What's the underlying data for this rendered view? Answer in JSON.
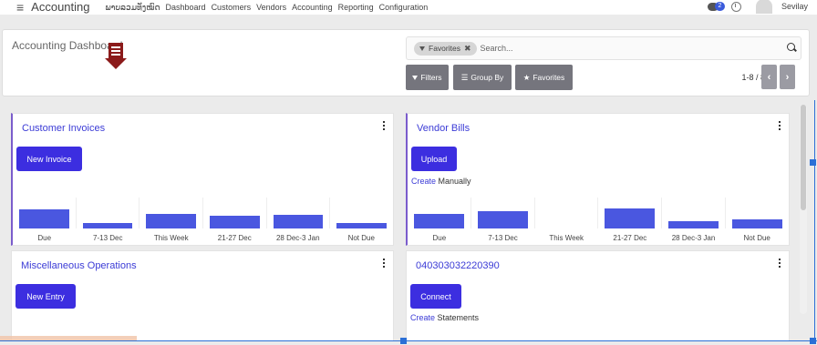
{
  "topnav": {
    "app_title": "Accounting",
    "menu": [
      "ພາບລວມທັງໝົດ",
      "Dashboard",
      "Customers",
      "Vendors",
      "Accounting",
      "Reporting",
      "Configuration"
    ],
    "chat_count": "2",
    "username": "Sevilay"
  },
  "control_panel": {
    "title": "Accounting Dashboard",
    "facet_label": "Favorites",
    "search_placeholder": "Search...",
    "filters_label": "Filters",
    "groupby_label": "Group By",
    "favorites_label": "Favorites",
    "pager": "1-8 / 8"
  },
  "cards": {
    "customer_invoices": {
      "title": "Customer Invoices",
      "button": "New Invoice",
      "graph": [
        {
          "label": "Due",
          "value": 0.62
        },
        {
          "label": "7-13 Dec",
          "value": 0.18
        },
        {
          "label": "This Week",
          "value": 0.48
        },
        {
          "label": "21-27 Dec",
          "value": 0.42
        },
        {
          "label": "28 Dec-3 Jan",
          "value": 0.45
        },
        {
          "label": "Not Due",
          "value": 0.18
        }
      ]
    },
    "vendor_bills": {
      "title": "Vendor Bills",
      "button": "Upload",
      "link": "Create",
      "link_suffix": "Manually",
      "graph": [
        {
          "label": "Due",
          "value": 0.48
        },
        {
          "label": "7-13 Dec",
          "value": 0.55
        },
        {
          "label": "This Week",
          "value": 0
        },
        {
          "label": "21-27 Dec",
          "value": 0.65
        },
        {
          "label": "28 Dec-3 Jan",
          "value": 0.25
        },
        {
          "label": "Not Due",
          "value": 0.3
        }
      ]
    },
    "misc_operations": {
      "title": "Miscellaneous Operations",
      "button": "New Entry"
    },
    "bank": {
      "title": "040303032220390",
      "button": "Connect",
      "link": "Create",
      "link_suffix": "Statements"
    }
  },
  "colors": {
    "accent": "#3c2ee0",
    "bar": "#4a57e0",
    "arrow": "#8b1a1a"
  }
}
